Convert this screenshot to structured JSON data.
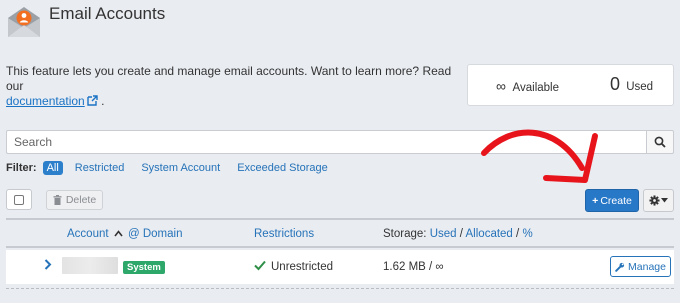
{
  "header": {
    "title": "Email Accounts",
    "icon": "email-envelope-icon"
  },
  "description": {
    "text": "This feature lets you create and manage email accounts. Want to learn more? Read our",
    "link_label": "documentation",
    "suffix": "."
  },
  "stats": {
    "available_symbol": "∞",
    "available_label": "Available",
    "used_value": "0",
    "used_label": "Used"
  },
  "search": {
    "placeholder": "Search"
  },
  "filter": {
    "label": "Filter:",
    "options": [
      "All",
      "Restricted",
      "System Account",
      "Exceeded Storage"
    ],
    "active": "All"
  },
  "toolbar": {
    "delete_label": "Delete",
    "create_label": "Create",
    "create_plus": "+"
  },
  "table": {
    "headers": {
      "account": "Account",
      "at_domain": "@ Domain",
      "restrictions": "Restrictions",
      "storage_prefix": "Storage:",
      "storage_used": "Used",
      "storage_sep1": "/",
      "storage_allocated": "Allocated",
      "storage_sep2": "/",
      "storage_percent": "%"
    },
    "rows": [
      {
        "badge": "System",
        "restrictions": "Unrestricted",
        "storage": "1.62 MB / ∞",
        "manage_label": "Manage"
      }
    ]
  },
  "colors": {
    "primary": "#2878c8",
    "link": "#2673b9",
    "badge_green": "#2ea76a",
    "annotation_red": "#e8141c"
  }
}
